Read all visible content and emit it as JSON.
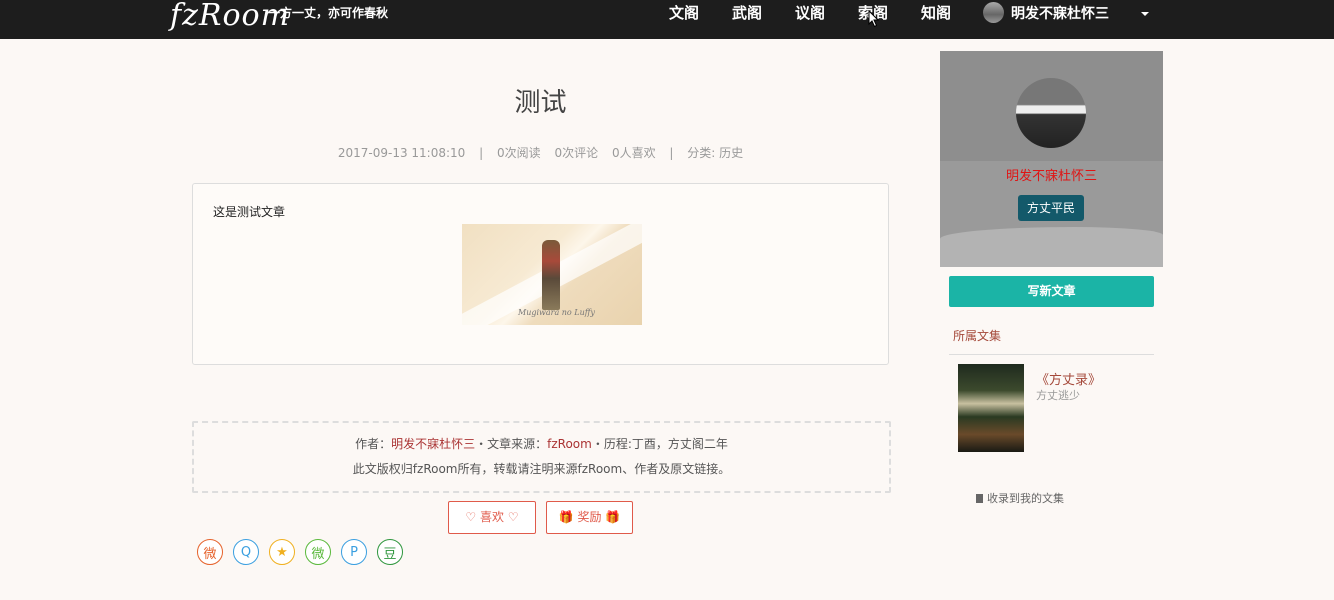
{
  "nav": {
    "logo": "fzRoom",
    "slogan": "一方一丈，亦可作春秋",
    "items": [
      {
        "label": "文阁"
      },
      {
        "label": "武阁"
      },
      {
        "label": "议阁"
      },
      {
        "label": "索阁"
      },
      {
        "label": "知阁"
      }
    ],
    "user": {
      "name": "明发不寐杜怀三",
      "avatar_icon": "user-avatar"
    }
  },
  "article": {
    "title": "测试",
    "date": "2017-09-13 11:08:10",
    "separator": "|",
    "reads": "0次阅读",
    "comments": "0次评论",
    "likes": "0人喜欢",
    "category": "分类: 历史",
    "body_text": "这是测试文章",
    "image_caption": "Mugiwara no Luffy"
  },
  "copyright": {
    "author_label": "作者：",
    "author": "明发不寐杜怀三",
    "dot1": "・",
    "source_label": "文章来源：",
    "source": "fzRoom",
    "dot2": "・",
    "history": "历程:丁酉，方丈阁二年",
    "notice": "此文版权归fzRoom所有，转载请注明来源fzRoom、作者及原文链接。"
  },
  "actions": {
    "like_label": "♡ 喜欢 ♡",
    "reward_label": "🎁 奖励 🎁"
  },
  "share": [
    {
      "name": "weibo-icon",
      "glyph": "微",
      "color": "#e6622b"
    },
    {
      "name": "qq-icon",
      "glyph": "Q",
      "color": "#3a9fe0"
    },
    {
      "name": "qzone-icon",
      "glyph": "★",
      "color": "#f0b020"
    },
    {
      "name": "wechat-icon",
      "glyph": "微",
      "color": "#5ab93c"
    },
    {
      "name": "tencent-weibo-icon",
      "glyph": "P",
      "color": "#3a9fe0"
    },
    {
      "name": "douban-icon",
      "glyph": "豆",
      "color": "#2e963d"
    }
  ],
  "sidebar": {
    "profile_name": "明发不寐杜怀三",
    "profile_rank": "方丈平民",
    "write_button": "写新文章",
    "collection_heading": "所属文集",
    "collection_title": "《方丈录》",
    "collection_sub": "方丈逃少",
    "collect_link": "收录到我的文集"
  },
  "colors": {
    "nav_bg": "#1d1d1d",
    "accent_teal": "#1bb4a6",
    "accent_red": "#e05a4a",
    "rank_badge": "#13596a",
    "profile_name": "#e01414"
  }
}
